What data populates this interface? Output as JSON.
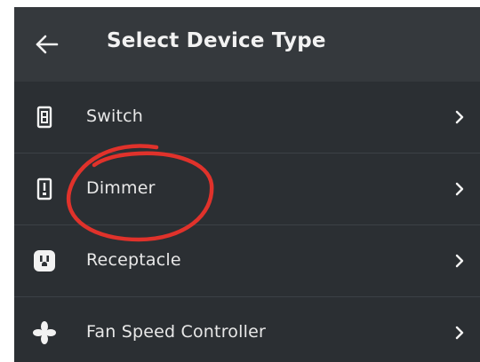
{
  "header": {
    "title": "Select Device Type",
    "back_icon": "arrow-left-icon"
  },
  "devices": [
    {
      "label": "Switch",
      "icon": "switch-icon"
    },
    {
      "label": "Dimmer",
      "icon": "dimmer-icon"
    },
    {
      "label": "Receptacle",
      "icon": "receptacle-icon"
    },
    {
      "label": "Fan Speed Controller",
      "icon": "fan-icon"
    }
  ],
  "colors": {
    "background": "#2b2f33",
    "header": "#35393d",
    "annotation": "#e0322b"
  }
}
